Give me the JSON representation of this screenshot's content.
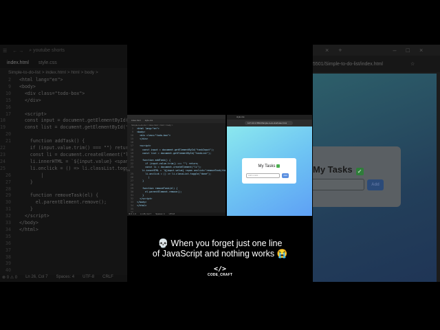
{
  "editor": {
    "search": "youtube shorts",
    "tabs": [
      "index.html",
      "style.css"
    ],
    "breadcrumb": "Simple-to-do-list > index.html > html > body >",
    "lines": [
      {
        "n": "2",
        "t": "<html lang=\"en\">"
      },
      {
        "n": "9",
        "t": "<body>"
      },
      {
        "n": "10",
        "t": "  <div class=\"todo-box\">"
      },
      {
        "n": "15",
        "t": "  </div>"
      },
      {
        "n": "16",
        "t": ""
      },
      {
        "n": "17",
        "t": "  <script>"
      },
      {
        "n": "18",
        "t": "    const input = document.getElementById(\"taskInput\");"
      },
      {
        "n": "19",
        "t": "    const list = document.getElementById(\"taskList\");"
      },
      {
        "n": "20",
        "t": ""
      },
      {
        "n": "21",
        "t": "    function addTask() {"
      },
      {
        "n": "22",
        "t": "      if (input.value.trim() === \"\") return;"
      },
      {
        "n": "23",
        "t": "      const li = document.createElement(\"li\");"
      },
      {
        "n": "24",
        "t": "      li.innerHTML = `${input.value} <span onclick=\"removeTask(this)\">"
      },
      {
        "n": "25",
        "t": "      li.onclick = () => li.classList.toggle(\"done\");"
      },
      {
        "n": "26",
        "t": "        |"
      },
      {
        "n": "27",
        "t": "    }"
      },
      {
        "n": "28",
        "t": ""
      },
      {
        "n": "29",
        "t": "    function removeTask(el) {"
      },
      {
        "n": "30",
        "t": "      el.parentElement.remove();"
      },
      {
        "n": "31",
        "t": "    }"
      },
      {
        "n": "32",
        "t": "  </script>"
      },
      {
        "n": "33",
        "t": "</body>"
      },
      {
        "n": "34",
        "t": "</html>"
      },
      {
        "n": "35",
        "t": ""
      },
      {
        "n": "36",
        "t": ""
      },
      {
        "n": "37",
        "t": ""
      },
      {
        "n": "38",
        "t": ""
      },
      {
        "n": "39",
        "t": ""
      },
      {
        "n": "40",
        "t": ""
      },
      {
        "n": "41",
        "t": ""
      }
    ],
    "status": {
      "problems": "⊗ 0 ⚠ 0",
      "position": "Ln 26, Col 7",
      "spaces": "Spaces: 4",
      "encoding": "UTF-8",
      "eol": "CRLF"
    }
  },
  "browser": {
    "url": "127.0.0.1:5501/Simple-to-do-list/index.html",
    "url_partial": "5501/Simple-to-do-list/index.html",
    "card_title": "My Tasks",
    "input_placeholder": "Add a task...",
    "add_button": "Add"
  },
  "caption": {
    "line1": "💀 When you forget just one line",
    "line2": "of JavaScript and nothing works 😭"
  },
  "logo": {
    "symbol": "</>",
    "name": "CODE_CRAFT"
  }
}
